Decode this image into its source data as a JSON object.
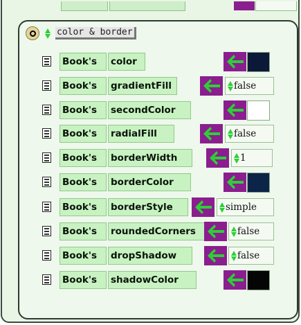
{
  "category": {
    "name": "color & border"
  },
  "rows": [
    {
      "owner": "Book's",
      "slot": "color",
      "kind": "color",
      "color": "#0b1838"
    },
    {
      "owner": "Book's",
      "slot": "gradientFill",
      "kind": "choice",
      "value": "false"
    },
    {
      "owner": "Book's",
      "slot": "secondColor",
      "kind": "color",
      "color": "#ffffff"
    },
    {
      "owner": "Book's",
      "slot": "radialFill",
      "kind": "choice",
      "value": "false"
    },
    {
      "owner": "Book's",
      "slot": "borderWidth",
      "kind": "number",
      "value": "1"
    },
    {
      "owner": "Book's",
      "slot": "borderColor",
      "kind": "color",
      "color": "#0b2448"
    },
    {
      "owner": "Book's",
      "slot": "borderStyle",
      "kind": "choice",
      "value": "simple"
    },
    {
      "owner": "Book's",
      "slot": "roundedCorners",
      "kind": "choice",
      "value": "false"
    },
    {
      "owner": "Book's",
      "slot": "dropShadow",
      "kind": "choice",
      "value": "false"
    },
    {
      "owner": "Book's",
      "slot": "shadowColor",
      "kind": "color",
      "color": "#050505"
    }
  ],
  "colors": {
    "tile_bg": "#c8f2c2",
    "arrow_bg": "#8a1e8e",
    "arrow_fg": "#2ecf36",
    "panel_bg": "#e9f6e6"
  },
  "icons": {
    "collapse": "collapse-circle-icon",
    "menu": "tile-menu-icon",
    "assign": "assign-arrow-icon",
    "updown": "up-down-arrows-icon"
  }
}
